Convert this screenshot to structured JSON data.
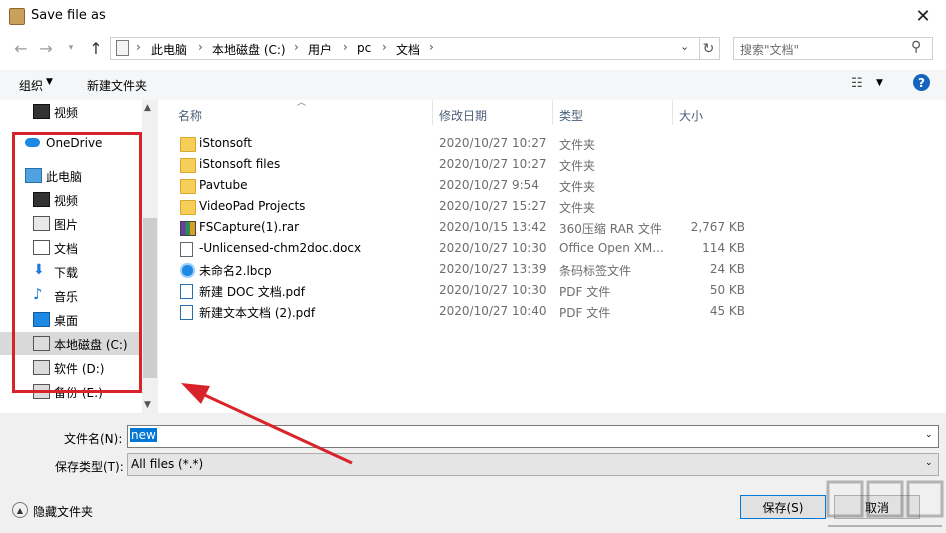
{
  "window": {
    "title": "Save file as"
  },
  "nav": {
    "breadcrumbs": [
      "此电脑",
      "本地磁盘 (C:)",
      "用户",
      "pc",
      "文档"
    ],
    "search_placeholder": "搜索\"文档\""
  },
  "toolbar": {
    "organize_label": "组织",
    "new_folder_label": "新建文件夹"
  },
  "sidebar": {
    "items": [
      {
        "label": "视频",
        "icon": "video-icon"
      },
      {
        "label": "OneDrive",
        "icon": "cloud-icon"
      },
      {
        "label": "此电脑",
        "icon": "computer-icon"
      },
      {
        "label": "视频",
        "icon": "video-icon"
      },
      {
        "label": "图片",
        "icon": "pictures-icon"
      },
      {
        "label": "文档",
        "icon": "documents-icon"
      },
      {
        "label": "下载",
        "icon": "download-icon"
      },
      {
        "label": "音乐",
        "icon": "music-icon"
      },
      {
        "label": "桌面",
        "icon": "desktop-icon"
      },
      {
        "label": "本地磁盘 (C:)",
        "icon": "drive-icon",
        "selected": true
      },
      {
        "label": "软件 (D:)",
        "icon": "drive-icon"
      },
      {
        "label": "备份 (E:)",
        "icon": "drive-icon"
      }
    ]
  },
  "columns": {
    "name": "名称",
    "date": "修改日期",
    "type": "类型",
    "size": "大小"
  },
  "files": [
    {
      "name": "iStonsoft",
      "date": "2020/10/27 10:27",
      "type": "文件夹",
      "size": "",
      "icon": "folder-icon"
    },
    {
      "name": "iStonsoft files",
      "date": "2020/10/27 10:27",
      "type": "文件夹",
      "size": "",
      "icon": "folder-icon"
    },
    {
      "name": "Pavtube",
      "date": "2020/10/27 9:54",
      "type": "文件夹",
      "size": "",
      "icon": "folder-icon"
    },
    {
      "name": "VideoPad Projects",
      "date": "2020/10/27 15:27",
      "type": "文件夹",
      "size": "",
      "icon": "folder-icon"
    },
    {
      "name": "FSCapture(1).rar",
      "date": "2020/10/15 13:42",
      "type": "360压缩 RAR 文件",
      "size": "2,767 KB",
      "icon": "rar-icon"
    },
    {
      "name": "-Unlicensed-chm2doc.docx",
      "date": "2020/10/27 10:30",
      "type": "Office Open XM...",
      "size": "114 KB",
      "icon": "docx-icon"
    },
    {
      "name": "未命名2.lbcp",
      "date": "2020/10/27 13:39",
      "type": "条码标签文件",
      "size": "24 KB",
      "icon": "lbcp-icon"
    },
    {
      "name": "新建 DOC 文档.pdf",
      "date": "2020/10/27 10:30",
      "type": "PDF 文件",
      "size": "50 KB",
      "icon": "pdf-icon"
    },
    {
      "name": "新建文本文档 (2).pdf",
      "date": "2020/10/27 10:40",
      "type": "PDF 文件",
      "size": "45 KB",
      "icon": "pdf-icon"
    }
  ],
  "form": {
    "filename_label": "文件名(N):",
    "filename_value": "new",
    "filetype_label": "保存类型(T):",
    "filetype_value": "All files (*.*)"
  },
  "footer": {
    "hide_folders_label": "隐藏文件夹",
    "save_label": "保存(S)",
    "cancel_label": "取消"
  },
  "colors": {
    "annotation_red": "#d9232a",
    "selection_blue": "#0078d7",
    "folder_yellow": "#f6cf5b"
  }
}
